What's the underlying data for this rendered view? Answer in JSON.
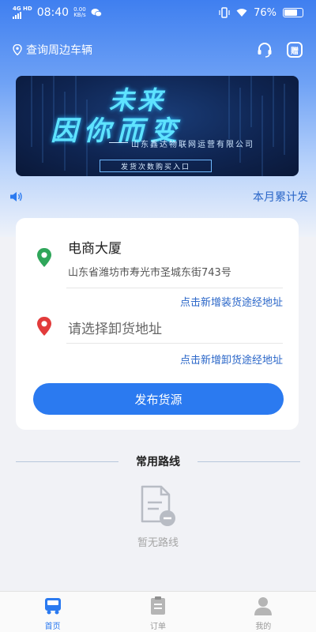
{
  "status_bar": {
    "network_type": "4G HD",
    "time": "08:40",
    "speed_value": "0.00",
    "speed_unit": "KB/s",
    "battery": "76%"
  },
  "header": {
    "location_text": "查询周边车辆",
    "icons": [
      "location-pin-icon",
      "headset-icon",
      "gift-icon"
    ],
    "gift_label": "赠"
  },
  "banner": {
    "title_line1": "未来",
    "title_line2": "因你而变",
    "company": "山东鑫达物联网运营有限公司",
    "button_label": "发货次数购买入口"
  },
  "notice": {
    "link_text": "本月累计发"
  },
  "order_card": {
    "load": {
      "name": "电商大厦",
      "address": "山东省潍坊市寿光市圣城东街743号"
    },
    "add_load_waypoint": "点击新增装货途经地址",
    "unload": {
      "placeholder": "请选择卸货地址"
    },
    "add_unload_waypoint": "点击新增卸货途经地址",
    "publish_button": "发布货源"
  },
  "routes": {
    "title": "常用路线",
    "empty_text": "暂无路线"
  },
  "tabbar": {
    "tabs": [
      {
        "label": "首页",
        "icon": "truck-icon",
        "active": true
      },
      {
        "label": "订单",
        "icon": "clipboard-icon",
        "active": false
      },
      {
        "label": "我的",
        "icon": "user-icon",
        "active": false
      }
    ]
  },
  "colors": {
    "primary": "#2b7af0",
    "link": "#2a66c8",
    "load_pin": "#2fa65a",
    "unload_pin": "#e23b3b"
  }
}
